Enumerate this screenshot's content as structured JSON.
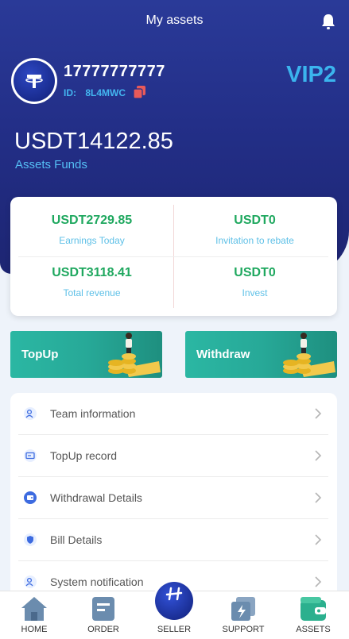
{
  "header": {
    "title": "My assets"
  },
  "profile": {
    "phone": "17777777777",
    "id_label": "ID:",
    "id_value": "8L4MWC",
    "vip": "VIP2"
  },
  "assets": {
    "balance": "USDT14122.85",
    "label": "Assets Funds"
  },
  "stats": [
    {
      "value": "USDT2729.85",
      "label": "Earnings Today"
    },
    {
      "value": "USDT0",
      "label": "Invitation to rebate"
    },
    {
      "value": "USDT3118.41",
      "label": "Total revenue"
    },
    {
      "value": "USDT0",
      "label": "Invest"
    }
  ],
  "actions": {
    "topup": "TopUp",
    "withdraw": "Withdraw"
  },
  "menu": [
    {
      "label": "Team information",
      "icon": "team-icon"
    },
    {
      "label": "TopUp record",
      "icon": "card-icon"
    },
    {
      "label": "Withdrawal Details",
      "icon": "wallet-icon"
    },
    {
      "label": "Bill Details",
      "icon": "shield-icon"
    },
    {
      "label": "System notification",
      "icon": "person-icon"
    }
  ],
  "tabs": [
    {
      "label": "HOME",
      "icon": "home-icon"
    },
    {
      "label": "ORDER",
      "icon": "order-icon"
    },
    {
      "label": "SELLER",
      "icon": "seller-icon"
    },
    {
      "label": "SUPPORT",
      "icon": "support-icon"
    },
    {
      "label": "ASSETS",
      "icon": "assets-icon"
    }
  ],
  "colors": {
    "primary": "#232f88",
    "accent": "#3bb4ee",
    "positive": "#1fa85f",
    "button": "#27a998"
  }
}
